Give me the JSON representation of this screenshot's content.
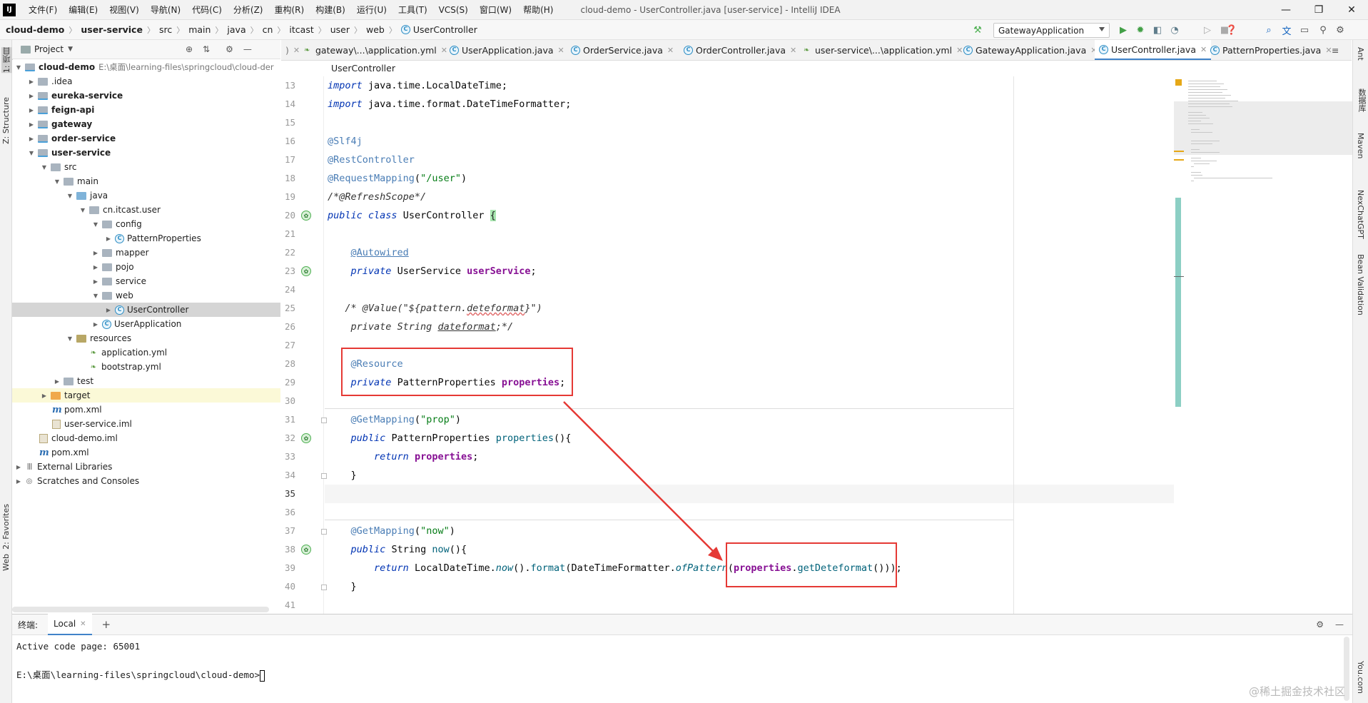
{
  "menubar": {
    "logo": "IJ",
    "items": [
      "文件(F)",
      "编辑(E)",
      "视图(V)",
      "导航(N)",
      "代码(C)",
      "分析(Z)",
      "重构(R)",
      "构建(B)",
      "运行(U)",
      "工具(T)",
      "VCS(S)",
      "窗口(W)",
      "帮助(H)"
    ],
    "window_title": "cloud-demo - UserController.java [user-service] - IntelliJ IDEA",
    "win_controls": [
      "—",
      "❐",
      "✕"
    ]
  },
  "navbar": {
    "crumbs": [
      "cloud-demo",
      "user-service",
      "src",
      "main",
      "java",
      "cn",
      "itcast",
      "user",
      "web",
      "UserController"
    ],
    "run_config": "GatewayApplication"
  },
  "left_strip": {
    "project": "1: 项目",
    "structure": "Z: Structure",
    "favorites": "2: Favorites",
    "web": "Web"
  },
  "project": {
    "title": "Project",
    "tree": [
      {
        "label": "cloud-demo",
        "extra": "E:\\桌面\\learning-files\\springcloud\\cloud-der"
      },
      {
        "label": ".idea"
      },
      {
        "label": "eureka-service"
      },
      {
        "label": "feign-api"
      },
      {
        "label": "gateway"
      },
      {
        "label": "order-service"
      },
      {
        "label": "user-service"
      },
      {
        "label": "src"
      },
      {
        "label": "main"
      },
      {
        "label": "java"
      },
      {
        "label": "cn.itcast.user"
      },
      {
        "label": "config"
      },
      {
        "label": "PatternProperties"
      },
      {
        "label": "mapper"
      },
      {
        "label": "pojo"
      },
      {
        "label": "service"
      },
      {
        "label": "web"
      },
      {
        "label": "UserController"
      },
      {
        "label": "UserApplication"
      },
      {
        "label": "resources"
      },
      {
        "label": "application.yml"
      },
      {
        "label": "bootstrap.yml"
      },
      {
        "label": "test"
      },
      {
        "label": "target"
      },
      {
        "label": "pom.xml"
      },
      {
        "label": "user-service.iml"
      },
      {
        "label": "cloud-demo.iml"
      },
      {
        "label": "pom.xml"
      },
      {
        "label": "External Libraries"
      },
      {
        "label": "Scratches and Consoles"
      }
    ]
  },
  "tabs": [
    {
      "label": "gateway\\...\\application.yml"
    },
    {
      "label": "UserApplication.java"
    },
    {
      "label": "OrderService.java"
    },
    {
      "label": "OrderController.java"
    },
    {
      "label": "user-service\\...\\application.yml"
    },
    {
      "label": "GatewayApplication.java"
    },
    {
      "label": "UserController.java"
    },
    {
      "label": "PatternProperties.java"
    }
  ],
  "editor": {
    "breadcrumb": "UserController",
    "line_numbers": [
      "13",
      "14",
      "15",
      "16",
      "17",
      "18",
      "19",
      "20",
      "21",
      "22",
      "23",
      "24",
      "25",
      "26",
      "27",
      "28",
      "29",
      "30",
      "31",
      "32",
      "33",
      "34",
      "35",
      "36",
      "37",
      "38",
      "39",
      "40",
      "41"
    ],
    "current_line": "35"
  },
  "right_strip": {
    "items": [
      "Ant",
      "数据库",
      "Maven",
      "NexChatGPT",
      "Bean Validation",
      "You.com"
    ]
  },
  "terminal": {
    "label": "终端:",
    "tab": "Local",
    "line1": "Active code page: 65001",
    "prompt": "E:\\桌面\\learning-files\\springcloud\\cloud-demo>"
  },
  "watermark": "@稀土掘金技术社区"
}
